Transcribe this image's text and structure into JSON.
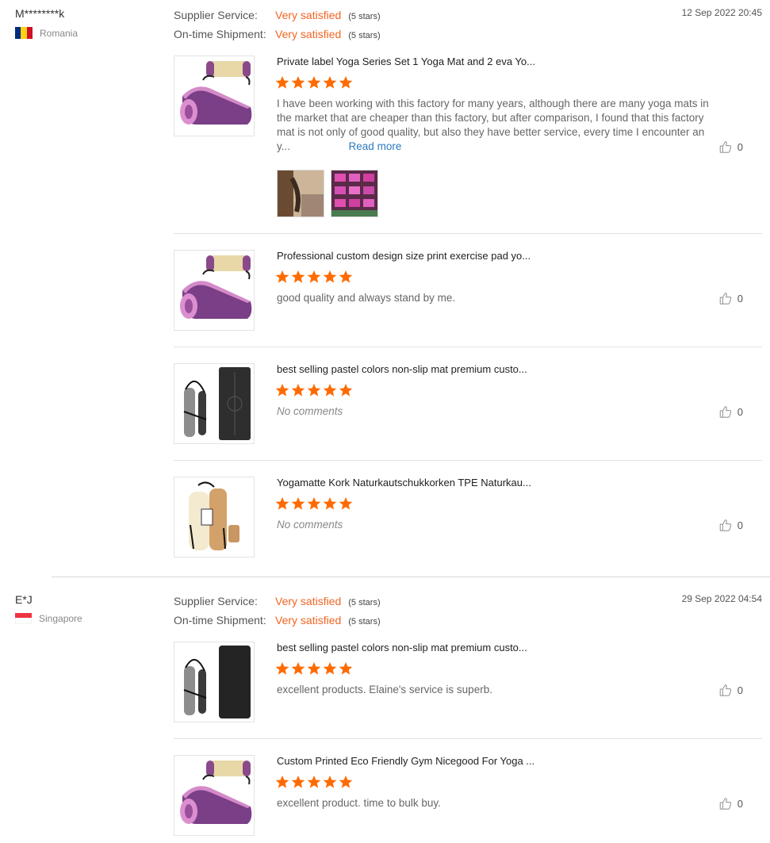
{
  "labels": {
    "supplier_service": "Supplier Service:",
    "shipment": "On-time Shipment:",
    "very_satisfied": "Very satisfied",
    "five_stars": "(5 stars)",
    "read_more": "Read more",
    "no_comments": "No comments"
  },
  "colors": {
    "accent": "#f26522",
    "link": "#2b7bc0",
    "star": "#ff6a00"
  },
  "reviews": [
    {
      "user": "M********k",
      "country": "Romania",
      "flag_icon": "romania-flag-icon",
      "date": "12 Sep 2022 20:45",
      "supplier_rating": "Very satisfied",
      "supplier_stars": "(5 stars)",
      "shipment_rating": "Very satisfied",
      "shipment_stars": "(5 stars)",
      "items": [
        {
          "title": "Private label Yoga Series Set 1 Yoga Mat and 2 eva Yo...",
          "stars": 5,
          "comment": "I have been working with this factory for many years, although there are many yoga mats in the market that are cheaper than this factory, but after comparison, I found that this factory mat is not only of good quality, but also they have better service, every time I encounter an y...",
          "likes": "0"
        },
        {
          "title": "Professional custom design size print exercise pad yo...",
          "stars": 5,
          "comment": "good quality and always stand by me.",
          "likes": "0"
        },
        {
          "title": "best selling pastel colors non-slip mat premium custo...",
          "stars": 5,
          "comment": "No comments",
          "likes": "0"
        },
        {
          "title": "Yogamatte Kork Naturkautschukkorken TPE Naturkau...",
          "stars": 5,
          "comment": "No comments",
          "likes": "0"
        }
      ]
    },
    {
      "user": "E*J",
      "country": "Singapore",
      "flag_icon": "singapore-flag-icon",
      "date": "29 Sep 2022 04:54",
      "supplier_rating": "Very satisfied",
      "supplier_stars": "(5 stars)",
      "shipment_rating": "Very satisfied",
      "shipment_stars": "(5 stars)",
      "items": [
        {
          "title": "best selling pastel colors non-slip mat premium custo...",
          "stars": 5,
          "comment": "excellent products. Elaine's service is superb.",
          "likes": "0"
        },
        {
          "title": "Custom Printed Eco Friendly Gym Nicegood For Yoga ...",
          "stars": 5,
          "comment": "excellent product. time to bulk buy.",
          "likes": "0"
        }
      ]
    }
  ]
}
